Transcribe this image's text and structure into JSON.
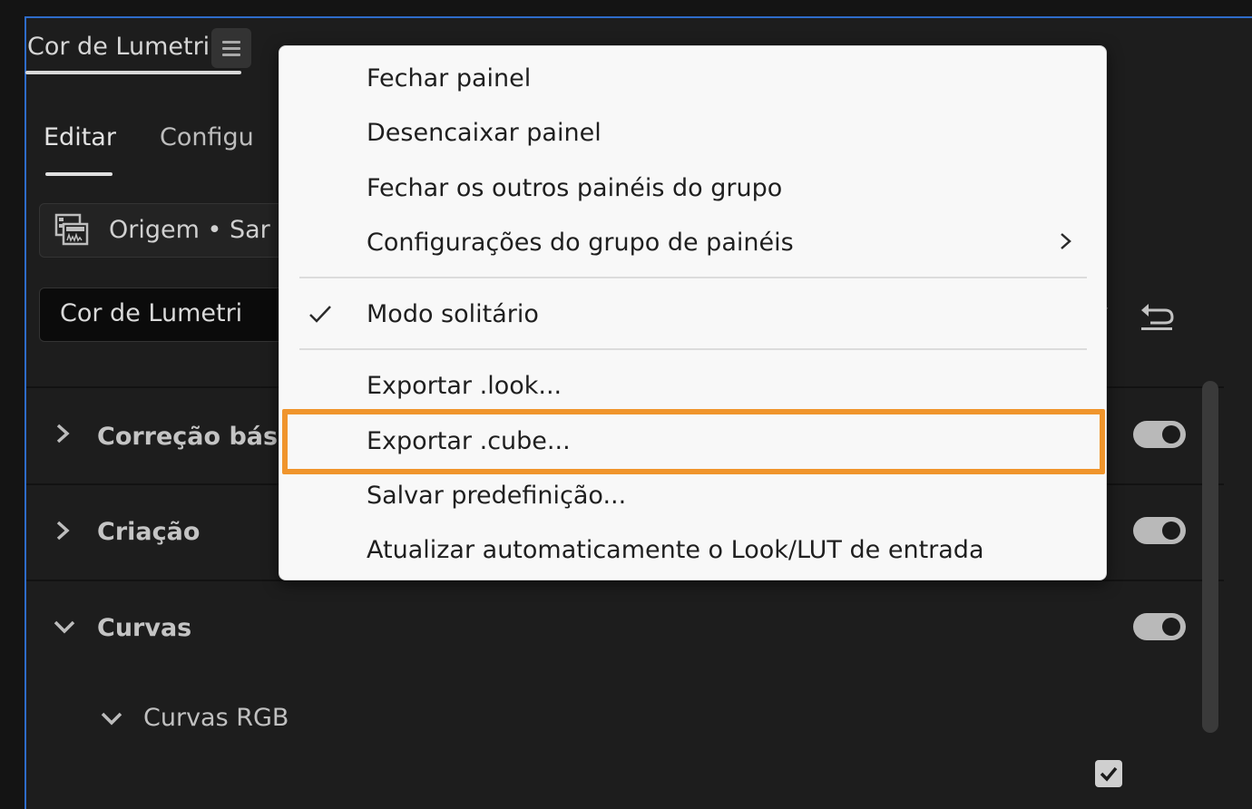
{
  "panel": {
    "tab_title": "Cor de Lumetri",
    "subtabs": {
      "edit": "Editar",
      "settings": "Configu"
    },
    "source": "Origem • Sar",
    "effect_select": "Cor de Lumetri"
  },
  "sections": [
    {
      "label": "Correção básica",
      "expanded": false,
      "enabled": true
    },
    {
      "label": "Criação",
      "expanded": false,
      "enabled": true
    },
    {
      "label": "Curvas",
      "expanded": true,
      "enabled": true
    }
  ],
  "subsection": {
    "label": "Curvas RGB",
    "expanded": true
  },
  "menu": {
    "items": {
      "close_panel": "Fechar painel",
      "undock_panel": "Desencaixar painel",
      "close_other_panels": "Fechar os outros painéis do grupo",
      "panel_group_settings": "Configurações do grupo de painéis",
      "solo_mode": "Modo solitário",
      "export_look": "Exportar .look...",
      "export_cube": "Exportar .cube...",
      "save_preset": "Salvar predefinição...",
      "auto_update_lut": "Atualizar automaticamente o Look/LUT de entrada"
    },
    "solo_mode_checked": true,
    "highlighted_item": "export_cube",
    "highlight_color": "#f0952c"
  },
  "colors": {
    "panel_border": "#2e6cc9",
    "panel_bg": "#1d1d1d",
    "menu_bg": "#f8f8f8"
  }
}
